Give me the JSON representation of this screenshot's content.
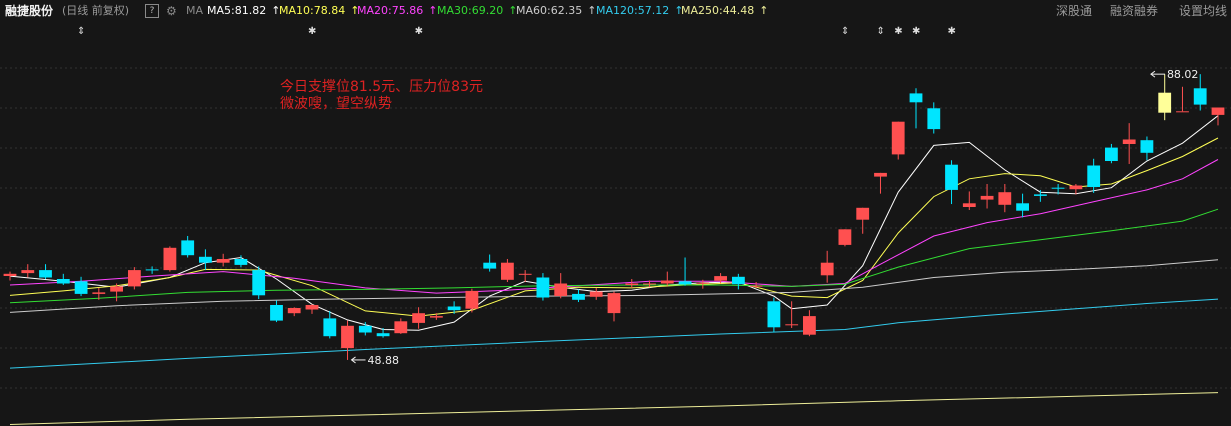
{
  "header": {
    "stock_name": "融捷股份",
    "period_label": "(日线 前复权)",
    "help_icon": "?",
    "settings_icon": "gear-icon",
    "ma_toggle": "MA",
    "indicators": [
      {
        "label": "MA5:81.82",
        "color": "#ffffff"
      },
      {
        "label": "MA10:78.84",
        "color": "#ffff55"
      },
      {
        "label": "MA20:75.86",
        "color": "#ff44ff"
      },
      {
        "label": "MA30:69.20",
        "color": "#33dd33"
      },
      {
        "label": "MA60:62.35",
        "color": "#cccccc"
      },
      {
        "label": "MA120:57.12",
        "color": "#33ccee"
      },
      {
        "label": "MA250:44.48",
        "color": "#eeee99"
      }
    ],
    "arrow_symbol": "↑",
    "links": {
      "sz_connect": "深股通",
      "margin": "融资融券",
      "set_ma": "设置均线"
    }
  },
  "annotation": {
    "line1": "今日支撑位81.5元、压力位83元",
    "line2": "微波嗖，望空纵势",
    "color": "#dd2222"
  },
  "chart_data": {
    "type": "candlestick",
    "ylim": [
      40,
      92
    ],
    "colors": {
      "up": "#ff5050",
      "down": "#00e5ff",
      "last": "#ffff99"
    },
    "candles": [
      [
        60.2,
        60.8,
        59.6,
        60.5
      ],
      [
        60.6,
        61.8,
        60.0,
        61.0
      ],
      [
        61.0,
        61.8,
        59.8,
        60.0
      ],
      [
        59.8,
        60.5,
        59.0,
        59.2
      ],
      [
        59.5,
        60.1,
        57.5,
        57.8
      ],
      [
        57.8,
        58.6,
        57.0,
        58.0
      ],
      [
        58.1,
        59.2,
        56.8,
        58.8
      ],
      [
        58.8,
        61.4,
        58.4,
        61.0
      ],
      [
        61.1,
        61.5,
        60.5,
        61.0
      ],
      [
        61.0,
        64.2,
        60.8,
        64.0
      ],
      [
        65.0,
        65.6,
        62.7,
        63.0
      ],
      [
        62.8,
        63.8,
        61.0,
        62.0
      ],
      [
        62.0,
        63.2,
        61.5,
        62.5
      ],
      [
        62.5,
        63.0,
        61.4,
        61.7
      ],
      [
        61.0,
        61.5,
        57.1,
        57.6
      ],
      [
        56.3,
        56.9,
        54.0,
        54.2
      ],
      [
        55.2,
        56.0,
        54.8,
        55.9
      ],
      [
        55.7,
        56.4,
        55.1,
        56.3
      ],
      [
        54.5,
        55.5,
        51.8,
        52.1
      ],
      [
        50.5,
        54.2,
        48.9,
        53.5
      ],
      [
        53.5,
        54.0,
        52.2,
        52.6
      ],
      [
        52.5,
        53.2,
        51.9,
        52.1
      ],
      [
        52.5,
        54.5,
        52.4,
        54.1
      ],
      [
        53.9,
        56.0,
        53.1,
        55.2
      ],
      [
        54.6,
        55.2,
        54.3,
        54.8
      ],
      [
        56.1,
        56.8,
        55.1,
        55.6
      ],
      [
        55.8,
        58.5,
        55.3,
        58.2
      ],
      [
        62.0,
        63.1,
        60.8,
        61.2
      ],
      [
        59.7,
        62.5,
        59.4,
        62.0
      ],
      [
        60.5,
        61.0,
        59.4,
        60.5
      ],
      [
        60.0,
        60.6,
        56.9,
        57.3
      ],
      [
        57.5,
        60.6,
        57.2,
        59.2
      ],
      [
        57.8,
        58.4,
        56.7,
        57.0
      ],
      [
        57.4,
        58.6,
        57.0,
        58.1
      ],
      [
        55.2,
        58.1,
        54.1,
        57.9
      ],
      [
        59.0,
        59.8,
        58.6,
        59.2
      ],
      [
        59.1,
        59.6,
        58.7,
        59.2
      ],
      [
        59.2,
        60.8,
        58.9,
        59.6
      ],
      [
        59.5,
        62.7,
        58.9,
        59.1
      ],
      [
        59.2,
        59.7,
        58.5,
        59.3
      ],
      [
        59.6,
        60.6,
        59.2,
        60.2
      ],
      [
        60.1,
        60.5,
        58.4,
        59.1
      ],
      [
        58.9,
        59.4,
        58.6,
        58.9
      ],
      [
        56.8,
        57.3,
        52.6,
        53.3
      ],
      [
        53.6,
        56.8,
        53.2,
        53.7
      ],
      [
        52.3,
        55.6,
        52.1,
        54.8
      ],
      [
        60.3,
        63.6,
        59.3,
        62.0
      ],
      [
        64.4,
        65.9,
        64.2,
        66.5
      ],
      [
        67.8,
        68.3,
        65.9,
        69.4
      ],
      [
        73.6,
        73.2,
        71.3,
        74.1
      ],
      [
        76.6,
        78.9,
        75.9,
        81.0
      ],
      [
        84.8,
        85.5,
        80.1,
        83.6
      ],
      [
        82.8,
        83.6,
        79.4,
        80.0
      ],
      [
        75.2,
        75.8,
        69.9,
        71.8
      ],
      [
        69.5,
        71.6,
        69.1,
        70.0
      ],
      [
        70.5,
        72.6,
        69.3,
        71.0
      ],
      [
        69.8,
        72.6,
        68.8,
        71.5
      ],
      [
        70.0,
        71.3,
        68.1,
        69.0
      ],
      [
        71.2,
        71.8,
        70.2,
        71.0
      ],
      [
        72.1,
        72.6,
        71.2,
        72.0
      ],
      [
        71.9,
        72.6,
        71.2,
        72.4
      ],
      [
        75.1,
        76.0,
        71.4,
        72.2
      ],
      [
        77.5,
        78.0,
        75.4,
        75.7
      ],
      [
        78.0,
        80.8,
        75.3,
        78.6
      ],
      [
        78.5,
        79.0,
        75.8,
        76.8
      ],
      [
        82.2,
        87.4,
        81.2,
        84.9
      ],
      [
        82.4,
        85.7,
        85.1,
        82.4
      ],
      [
        85.5,
        87.4,
        82.5,
        83.3
      ],
      [
        81.9,
        82.5,
        80.5,
        82.9
      ]
    ],
    "min_label": "48.88",
    "max_label": "88.02",
    "markers": [
      {
        "i": 4,
        "symbol": "⇕"
      },
      {
        "i": 17,
        "symbol": "✱"
      },
      {
        "i": 23,
        "symbol": "✱"
      },
      {
        "i": 47,
        "symbol": "⇕"
      },
      {
        "i": 49,
        "symbol": "⇕"
      },
      {
        "i": 50,
        "symbol": "✱"
      },
      {
        "i": 51,
        "symbol": "✱"
      },
      {
        "i": 53,
        "symbol": "✱"
      }
    ],
    "ma_lines": [
      {
        "name": "MA5",
        "color": "#ffffff",
        "points": [
          [
            0,
            60.2
          ],
          [
            3,
            59.5
          ],
          [
            6,
            58.7
          ],
          [
            9,
            60.0
          ],
          [
            11,
            62.0
          ],
          [
            13,
            62.7
          ],
          [
            15,
            59.8
          ],
          [
            17,
            56.4
          ],
          [
            19,
            54.3
          ],
          [
            21,
            53.0
          ],
          [
            23,
            52.9
          ],
          [
            25,
            54.0
          ],
          [
            27,
            57.5
          ],
          [
            29,
            59.5
          ],
          [
            31,
            58.7
          ],
          [
            33,
            58.1
          ],
          [
            35,
            58.3
          ],
          [
            37,
            59.0
          ],
          [
            39,
            59.3
          ],
          [
            41,
            59.4
          ],
          [
            43,
            57.5
          ],
          [
            44,
            55.8
          ],
          [
            46,
            56.3
          ],
          [
            48,
            61.6
          ],
          [
            50,
            71.5
          ],
          [
            52,
            77.8
          ],
          [
            54,
            78.2
          ],
          [
            56,
            74.5
          ],
          [
            58,
            71.5
          ],
          [
            60,
            71.3
          ],
          [
            62,
            72.1
          ],
          [
            64,
            75.7
          ],
          [
            66,
            78.1
          ],
          [
            68,
            81.8
          ]
        ]
      },
      {
        "name": "MA10",
        "color": "#ffff55",
        "points": [
          [
            0,
            57.6
          ],
          [
            3,
            58.2
          ],
          [
            6,
            58.9
          ],
          [
            9,
            60.0
          ],
          [
            11,
            61.1
          ],
          [
            14,
            61.0
          ],
          [
            17,
            58.9
          ],
          [
            20,
            55.5
          ],
          [
            23,
            54.8
          ],
          [
            26,
            55.6
          ],
          [
            29,
            58.2
          ],
          [
            32,
            58.7
          ],
          [
            35,
            58.6
          ],
          [
            38,
            59.0
          ],
          [
            41,
            59.3
          ],
          [
            44,
            57.5
          ],
          [
            46,
            57.3
          ],
          [
            48,
            59.6
          ],
          [
            50,
            66.0
          ],
          [
            52,
            70.9
          ],
          [
            54,
            73.3
          ],
          [
            56,
            74.0
          ],
          [
            58,
            73.7
          ],
          [
            60,
            72.2
          ],
          [
            62,
            72.6
          ],
          [
            64,
            74.4
          ],
          [
            66,
            76.3
          ],
          [
            68,
            78.8
          ]
        ]
      },
      {
        "name": "MA20",
        "color": "#ff44ff",
        "points": [
          [
            0,
            59.0
          ],
          [
            4,
            59.5
          ],
          [
            8,
            60.2
          ],
          [
            12,
            60.8
          ],
          [
            16,
            59.9
          ],
          [
            20,
            58.6
          ],
          [
            24,
            57.9
          ],
          [
            28,
            58.3
          ],
          [
            32,
            58.9
          ],
          [
            36,
            59.5
          ],
          [
            40,
            59.5
          ],
          [
            44,
            58.8
          ],
          [
            47,
            59.2
          ],
          [
            49,
            61.8
          ],
          [
            52,
            65.6
          ],
          [
            55,
            67.4
          ],
          [
            58,
            68.6
          ],
          [
            61,
            70.2
          ],
          [
            64,
            71.8
          ],
          [
            66,
            73.3
          ],
          [
            68,
            75.9
          ]
        ]
      },
      {
        "name": "MA30",
        "color": "#33dd33",
        "points": [
          [
            0,
            56.6
          ],
          [
            5,
            57.2
          ],
          [
            10,
            58.0
          ],
          [
            15,
            58.3
          ],
          [
            20,
            58.4
          ],
          [
            25,
            58.6
          ],
          [
            30,
            58.9
          ],
          [
            35,
            59.0
          ],
          [
            40,
            59.0
          ],
          [
            44,
            58.8
          ],
          [
            47,
            59.1
          ],
          [
            50,
            61.4
          ],
          [
            54,
            63.9
          ],
          [
            58,
            65.1
          ],
          [
            62,
            66.3
          ],
          [
            66,
            67.6
          ],
          [
            68,
            69.2
          ]
        ]
      },
      {
        "name": "MA60",
        "color": "#cccccc",
        "points": [
          [
            0,
            55.3
          ],
          [
            6,
            56.2
          ],
          [
            12,
            56.8
          ],
          [
            18,
            57.1
          ],
          [
            24,
            57.3
          ],
          [
            30,
            57.5
          ],
          [
            36,
            57.6
          ],
          [
            40,
            57.8
          ],
          [
            44,
            58.0
          ],
          [
            48,
            58.7
          ],
          [
            52,
            60.0
          ],
          [
            56,
            60.7
          ],
          [
            60,
            61.1
          ],
          [
            64,
            61.6
          ],
          [
            68,
            62.4
          ]
        ]
      },
      {
        "name": "MA120",
        "color": "#33ccee",
        "points": [
          [
            0,
            47.8
          ],
          [
            10,
            49.1
          ],
          [
            20,
            50.3
          ],
          [
            30,
            51.4
          ],
          [
            40,
            52.4
          ],
          [
            47,
            53.0
          ],
          [
            50,
            53.9
          ],
          [
            55,
            54.9
          ],
          [
            60,
            55.8
          ],
          [
            64,
            56.5
          ],
          [
            68,
            57.1
          ]
        ]
      },
      {
        "name": "MA250",
        "color": "#eeee99",
        "points": [
          [
            0,
            40.2
          ],
          [
            10,
            40.9
          ],
          [
            20,
            41.5
          ],
          [
            30,
            42.1
          ],
          [
            40,
            42.7
          ],
          [
            50,
            43.4
          ],
          [
            60,
            44.0
          ],
          [
            68,
            44.5
          ]
        ]
      }
    ]
  }
}
